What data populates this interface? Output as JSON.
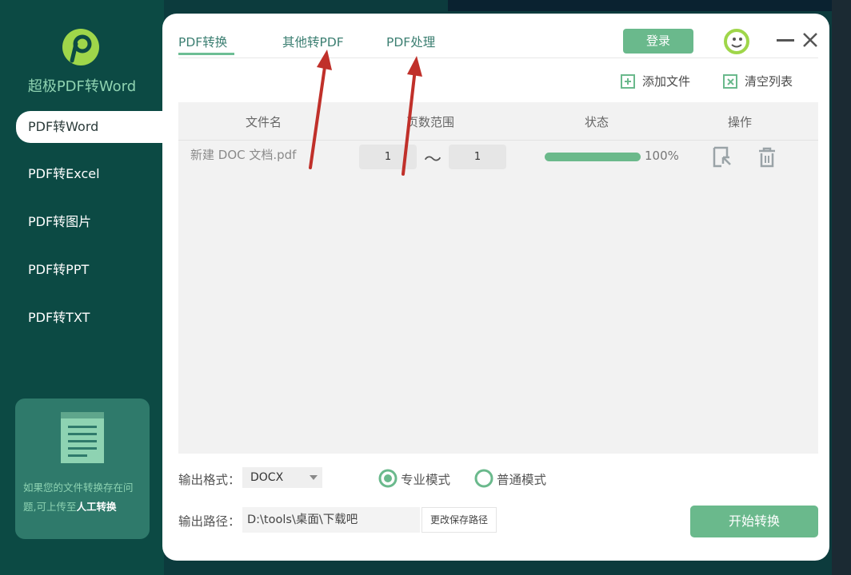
{
  "app": {
    "brand": "超极PDF转Word",
    "colors": {
      "sidebar": "#0c4a44",
      "accent": "#6ab98c",
      "tab_text": "#3c7f72"
    }
  },
  "sidebar": {
    "items": [
      {
        "label": "PDF转Word",
        "active": true
      },
      {
        "label": "PDF转Excel",
        "active": false
      },
      {
        "label": "PDF转图片",
        "active": false
      },
      {
        "label": "PDF转PPT",
        "active": false
      },
      {
        "label": "PDF转TXT",
        "active": false
      }
    ],
    "help": {
      "text": "如果您的文件转换存在问题,可上传至",
      "link": "人工转换"
    }
  },
  "tabs": [
    {
      "label": "PDF转换",
      "active": true
    },
    {
      "label": "其他转PDF",
      "active": false
    },
    {
      "label": "PDF处理",
      "active": false
    }
  ],
  "header": {
    "login_label": "登录"
  },
  "toolbar": {
    "add_files": "添加文件",
    "clear_list": "清空列表"
  },
  "table": {
    "columns": [
      "文件名",
      "页数范围",
      "状态",
      "操作"
    ],
    "rows": [
      {
        "filename": "新建 DOC 文档.pdf",
        "range_start": "1",
        "range_sep": "～",
        "range_end": "1",
        "progress_pct": 100,
        "progress_text": "100%"
      }
    ]
  },
  "options": {
    "format_label": "输出格式：",
    "format_value": "DOCX",
    "mode_pro": "专业模式",
    "mode_normal": "普通模式",
    "selected_mode": "pro",
    "path_label": "输出路径：",
    "path_value": "D:\\tools\\桌面\\下载吧",
    "change_path": "更改保存路径",
    "start": "开始转换"
  }
}
